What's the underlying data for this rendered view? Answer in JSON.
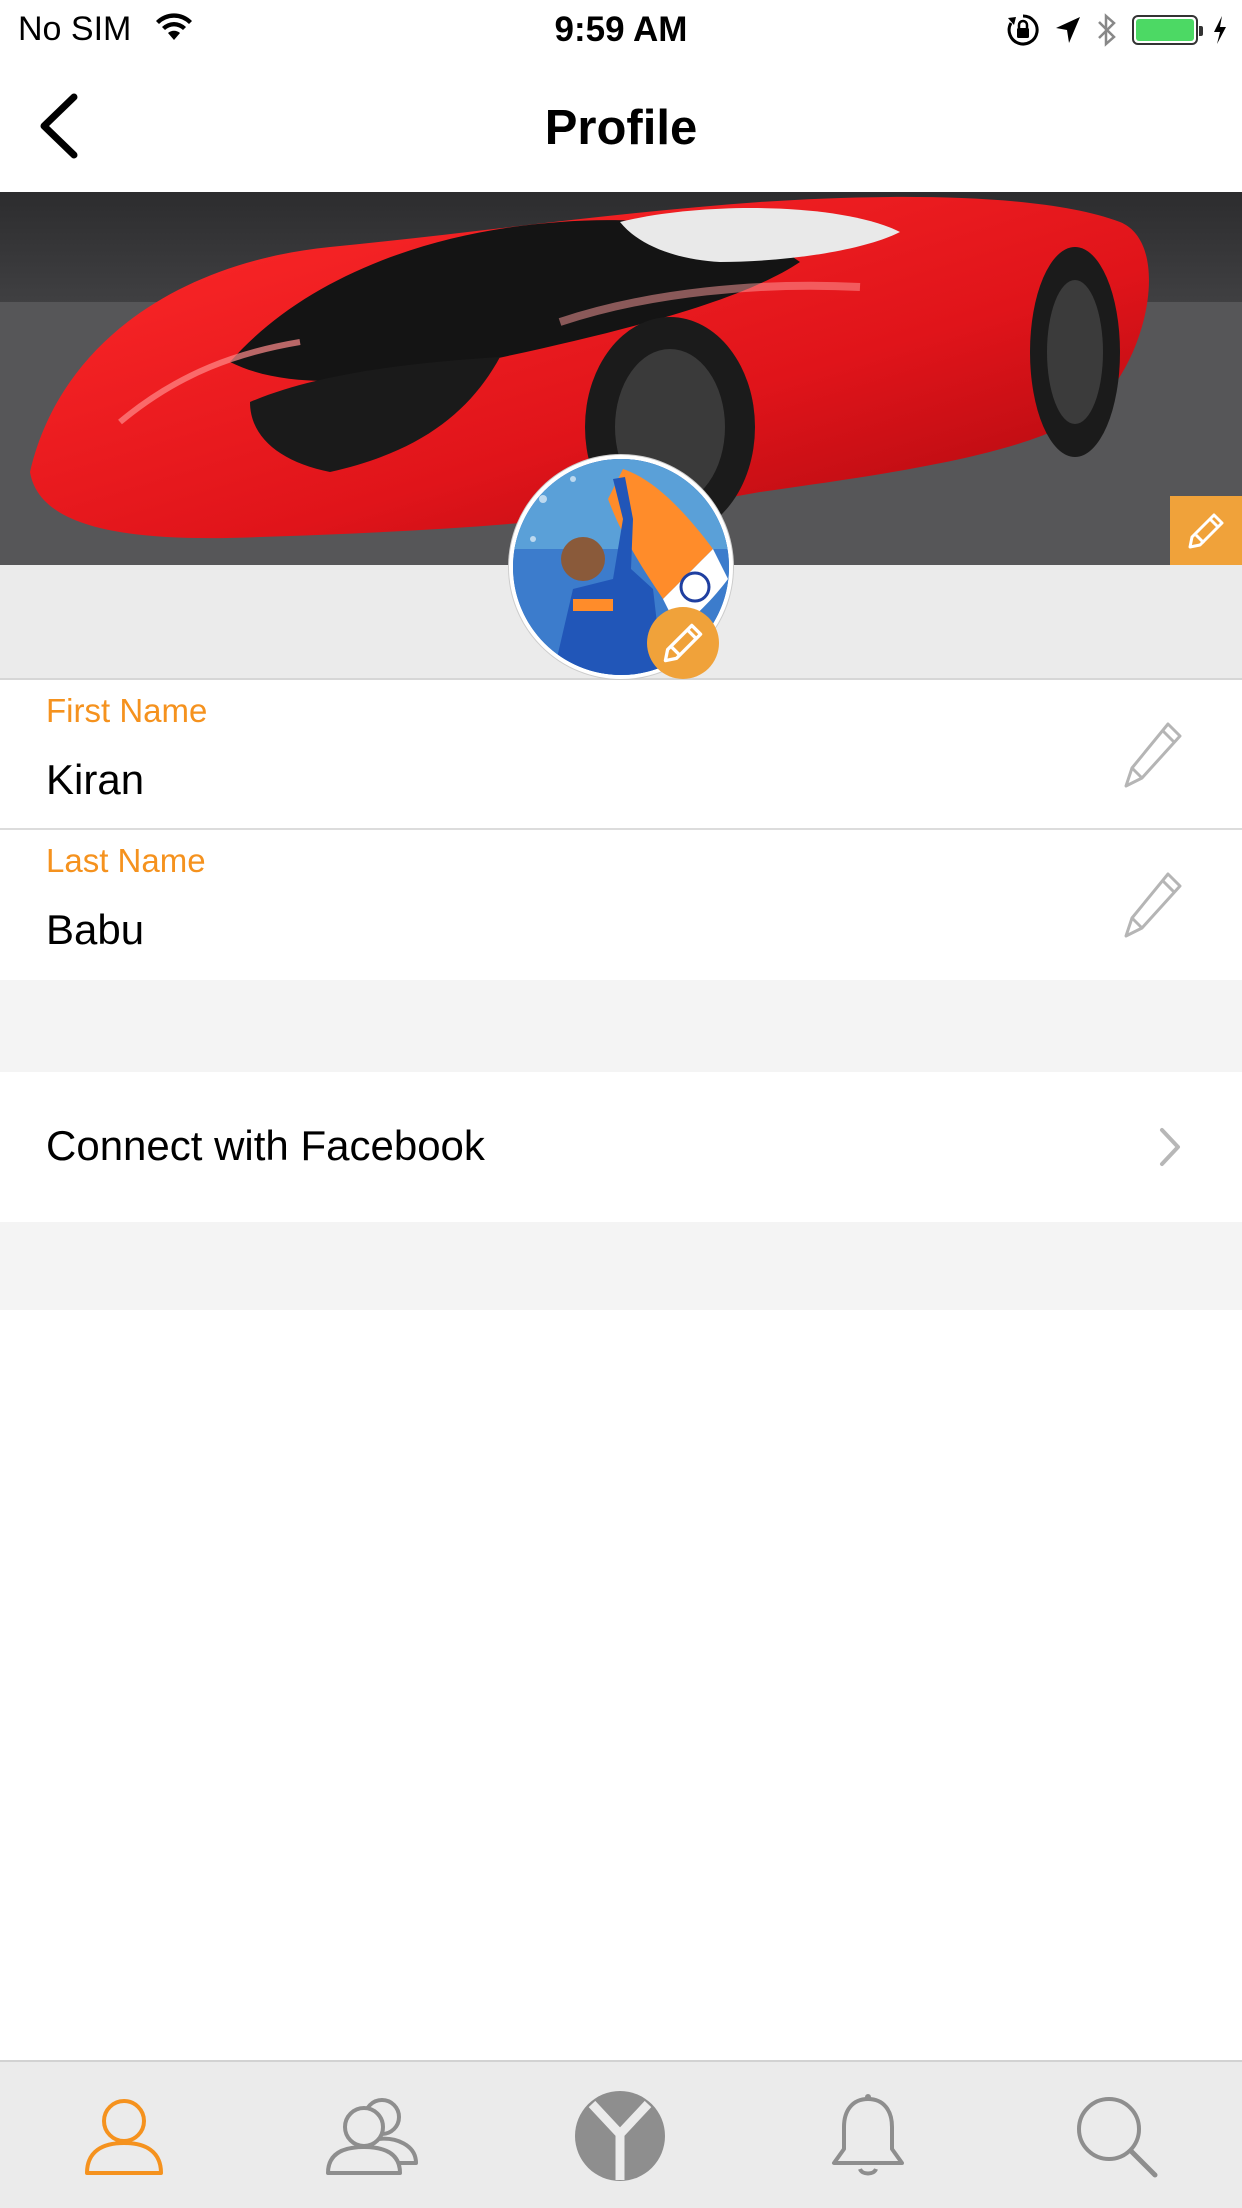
{
  "status_bar": {
    "carrier": "No SIM",
    "time": "9:59 AM",
    "battery_color": "#4cd964"
  },
  "nav": {
    "title": "Profile",
    "back_icon": "chevron-left-icon"
  },
  "profile": {
    "cover_image": "red sports car",
    "avatar_image": "person holding flag",
    "edit_icon": "pencil-icon",
    "accent_color": "#f0a23a"
  },
  "fields": {
    "first_name": {
      "label": "First Name",
      "value": "Kiran"
    },
    "last_name": {
      "label": "Last Name",
      "value": "Babu"
    }
  },
  "facebook": {
    "label": "Connect with Facebook"
  },
  "tabs": [
    {
      "icon": "profile-icon",
      "active": true
    },
    {
      "icon": "friends-icon",
      "active": false
    },
    {
      "icon": "app-logo-icon",
      "active": false
    },
    {
      "icon": "bell-icon",
      "active": false
    },
    {
      "icon": "search-icon",
      "active": false
    }
  ],
  "colors": {
    "label_orange": "#f5921e",
    "tab_active": "#f5921e",
    "tab_inactive": "#8e8e8e"
  }
}
